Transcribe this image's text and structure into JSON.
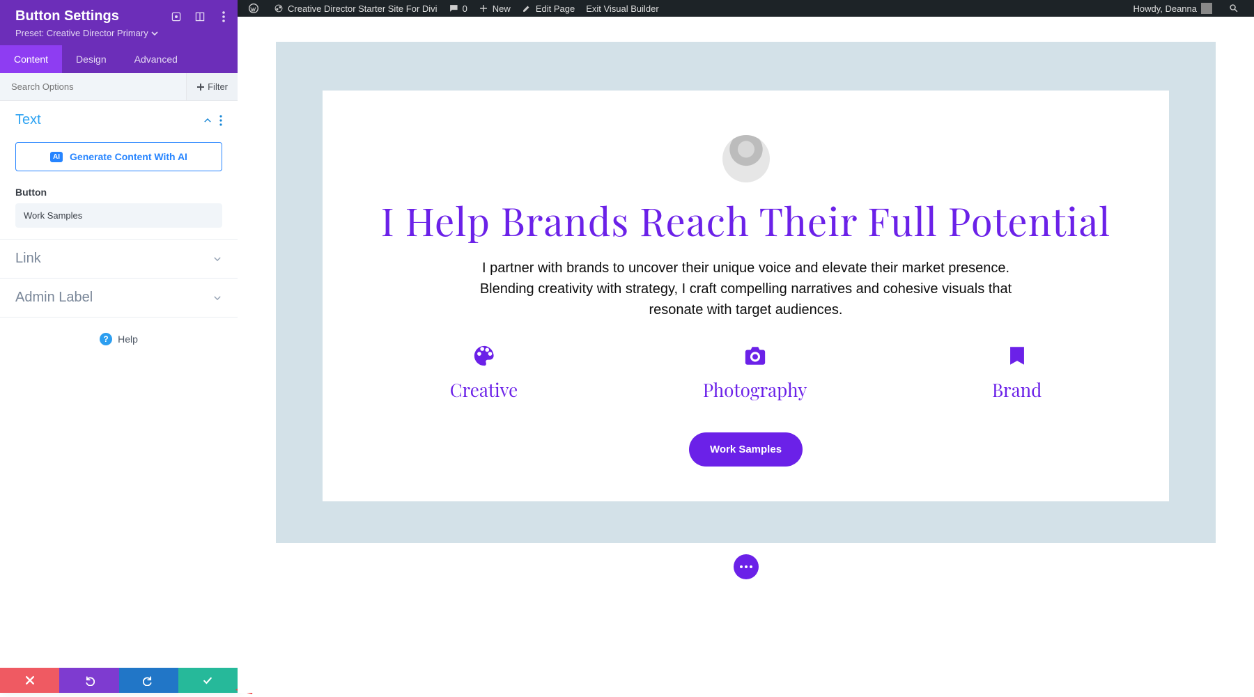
{
  "wpbar": {
    "site_title": "Creative Director Starter Site For Divi",
    "comments_count": "0",
    "new_label": "New",
    "edit_page": "Edit Page",
    "exit_builder": "Exit Visual Builder",
    "howdy": "Howdy, Deanna"
  },
  "sidebar": {
    "title": "Button Settings",
    "preset_label": "Preset: Creative Director Primary",
    "tabs": {
      "content": "Content",
      "design": "Design",
      "advanced": "Advanced"
    },
    "search_placeholder": "Search Options",
    "filter_label": "Filter",
    "sections": {
      "text": {
        "title": "Text",
        "generate_ai": "Generate Content With AI",
        "button_field_label": "Button",
        "button_value": "Work Samples"
      },
      "link": {
        "title": "Link"
      },
      "admin_label": {
        "title": "Admin Label"
      }
    },
    "help_label": "Help"
  },
  "page": {
    "headline": "I Help Brands Reach Their Full Potential",
    "subtext": "I partner with brands to uncover their unique voice and elevate their market presence. Blending creativity with strategy, I craft compelling narratives and cohesive visuals that resonate with target audiences.",
    "features": [
      {
        "label": "Creative"
      },
      {
        "label": "Photography"
      },
      {
        "label": "Brand"
      }
    ],
    "cta_label": "Work Samples"
  }
}
